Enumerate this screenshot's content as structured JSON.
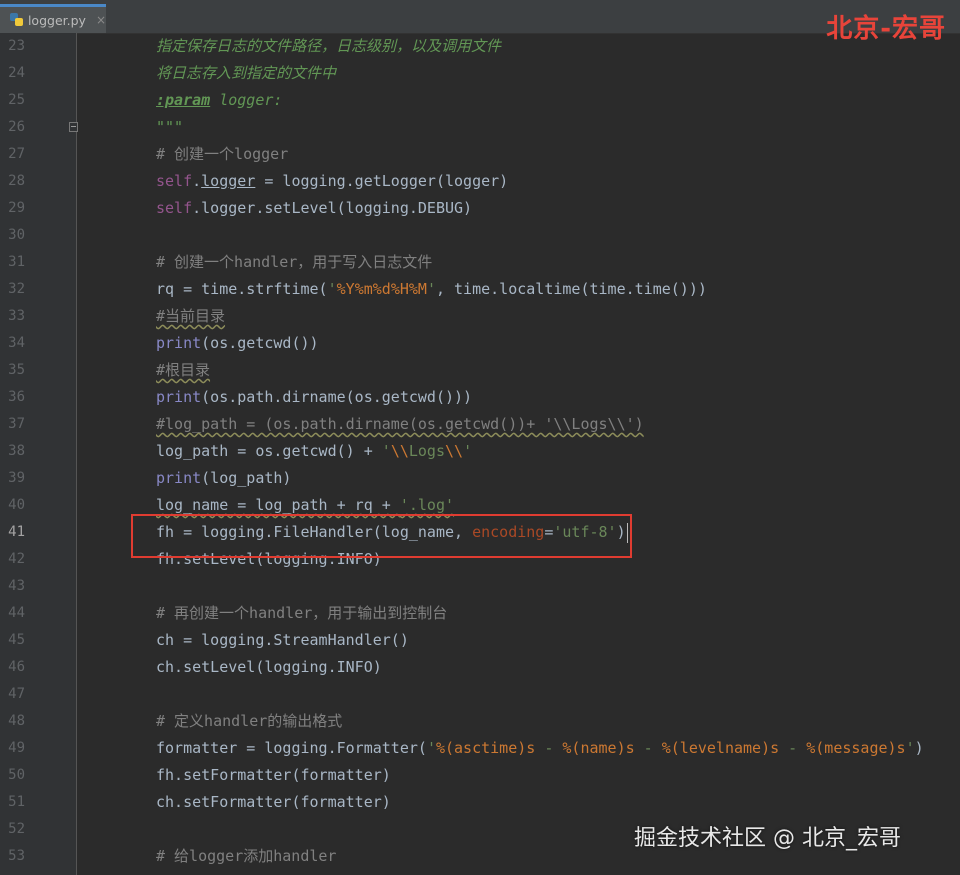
{
  "tab": {
    "filename": "logger.py",
    "close": "×"
  },
  "watermarks": {
    "top": "北京-宏哥",
    "bottom": "掘金技术社区 @ 北京_宏哥"
  },
  "editor": {
    "active_line": 41,
    "lines": [
      {
        "n": "23",
        "t": "指定保存日志的文件路径，日志级别，以及调用文件"
      },
      {
        "n": "24",
        "t": "将日志存入到指定的文件中"
      },
      {
        "n": "25",
        "t": ":param logger:"
      },
      {
        "n": "26",
        "t": "\"\"\""
      },
      {
        "n": "27",
        "t": "# 创建一个logger"
      },
      {
        "n": "28",
        "t": "self.logger = logging.getLogger(logger)"
      },
      {
        "n": "29",
        "t": "self.logger.setLevel(logging.DEBUG)"
      },
      {
        "n": "30",
        "t": ""
      },
      {
        "n": "31",
        "t": "# 创建一个handler，用于写入日志文件"
      },
      {
        "n": "32",
        "t": "rq = time.strftime('%Y%m%d%H%M', time.localtime(time.time()))"
      },
      {
        "n": "33",
        "t": "#当前目录"
      },
      {
        "n": "34",
        "t": "print(os.getcwd())"
      },
      {
        "n": "35",
        "t": "#根目录"
      },
      {
        "n": "36",
        "t": "print(os.path.dirname(os.getcwd()))"
      },
      {
        "n": "37",
        "t": "#log_path = (os.path.dirname(os.getcwd())+ '\\\\Logs\\\\')"
      },
      {
        "n": "38",
        "t": "log_path = os.getcwd() + '\\\\Logs\\\\'"
      },
      {
        "n": "39",
        "t": "print(log_path)"
      },
      {
        "n": "40",
        "t": "log_name = log_path + rq + '.log'"
      },
      {
        "n": "41",
        "t": "fh = logging.FileHandler(log_name, encoding='utf-8')"
      },
      {
        "n": "42",
        "t": "fh.setLevel(logging.INFO)"
      },
      {
        "n": "43",
        "t": ""
      },
      {
        "n": "44",
        "t": "# 再创建一个handler，用于输出到控制台"
      },
      {
        "n": "45",
        "t": "ch = logging.StreamHandler()"
      },
      {
        "n": "46",
        "t": "ch.setLevel(logging.INFO)"
      },
      {
        "n": "47",
        "t": ""
      },
      {
        "n": "48",
        "t": "# 定义handler的输出格式"
      },
      {
        "n": "49",
        "t": "formatter = logging.Formatter('%(asctime)s - %(name)s - %(levelname)s - %(message)s')"
      },
      {
        "n": "50",
        "t": "fh.setFormatter(formatter)"
      },
      {
        "n": "51",
        "t": "ch.setFormatter(formatter)"
      },
      {
        "n": "52",
        "t": ""
      },
      {
        "n": "53",
        "t": "# 给logger添加handler"
      }
    ]
  },
  "colors": {
    "background": "#2b2b2b",
    "docstring": "#629755",
    "comment": "#808080",
    "self": "#94558d",
    "builtin": "#8888c6",
    "string": "#6a8759",
    "keyword_arg": "#aa4926",
    "highlight_box": "#e03c31"
  }
}
